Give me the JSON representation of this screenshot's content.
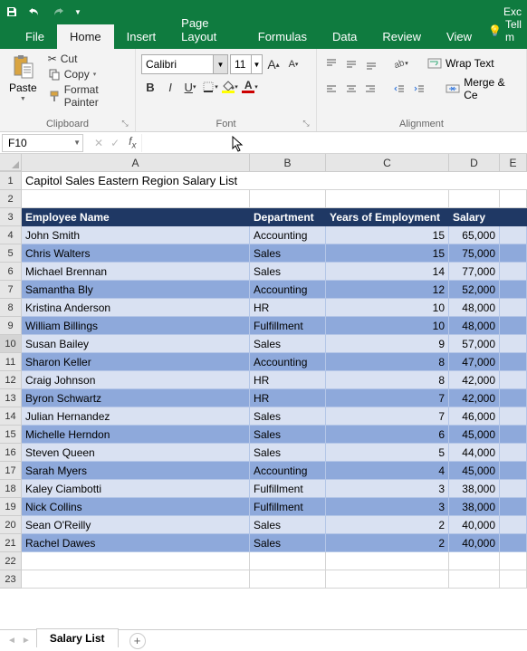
{
  "app": {
    "title": "Exc"
  },
  "tabs": [
    "File",
    "Home",
    "Insert",
    "Page Layout",
    "Formulas",
    "Data",
    "Review",
    "View"
  ],
  "active_tab": "Home",
  "tell_me": "Tell m",
  "clipboard": {
    "paste": "Paste",
    "cut": "Cut",
    "copy": "Copy",
    "format_painter": "Format Painter",
    "label": "Clipboard"
  },
  "font": {
    "name": "Calibri",
    "size": "11",
    "label": "Font"
  },
  "alignment": {
    "wrap": "Wrap Text",
    "merge": "Merge & Ce",
    "label": "Alignment"
  },
  "namebox": "F10",
  "sheet": {
    "title": "Capitol Sales Eastern Region Salary List",
    "headers": [
      "Employee Name",
      "Department",
      "Years of Employment",
      "Salary"
    ],
    "rows": [
      {
        "name": "John Smith",
        "dept": "Accounting",
        "years": "15",
        "salary": "65,000"
      },
      {
        "name": "Chris Walters",
        "dept": "Sales",
        "years": "15",
        "salary": "75,000"
      },
      {
        "name": "Michael Brennan",
        "dept": "Sales",
        "years": "14",
        "salary": "77,000"
      },
      {
        "name": "Samantha Bly",
        "dept": "Accounting",
        "years": "12",
        "salary": "52,000"
      },
      {
        "name": "Kristina Anderson",
        "dept": "HR",
        "years": "10",
        "salary": "48,000"
      },
      {
        "name": "William Billings",
        "dept": "Fulfillment",
        "years": "10",
        "salary": "48,000"
      },
      {
        "name": "Susan Bailey",
        "dept": "Sales",
        "years": "9",
        "salary": "57,000"
      },
      {
        "name": "Sharon Keller",
        "dept": "Accounting",
        "years": "8",
        "salary": "47,000"
      },
      {
        "name": "Craig Johnson",
        "dept": "HR",
        "years": "8",
        "salary": "42,000"
      },
      {
        "name": "Byron Schwartz",
        "dept": "HR",
        "years": "7",
        "salary": "42,000"
      },
      {
        "name": "Julian Hernandez",
        "dept": "Sales",
        "years": "7",
        "salary": "46,000"
      },
      {
        "name": "Michelle Herndon",
        "dept": "Sales",
        "years": "6",
        "salary": "45,000"
      },
      {
        "name": "Steven Queen",
        "dept": "Sales",
        "years": "5",
        "salary": "44,000"
      },
      {
        "name": "Sarah Myers",
        "dept": "Accounting",
        "years": "4",
        "salary": "45,000"
      },
      {
        "name": "Kaley Ciambotti",
        "dept": "Fulfillment",
        "years": "3",
        "salary": "38,000"
      },
      {
        "name": "Nick Collins",
        "dept": "Fulfillment",
        "years": "3",
        "salary": "38,000"
      },
      {
        "name": "Sean O'Reilly",
        "dept": "Sales",
        "years": "2",
        "salary": "40,000"
      },
      {
        "name": "Rachel Dawes",
        "dept": "Sales",
        "years": "2",
        "salary": "40,000"
      }
    ],
    "tab_name": "Salary List"
  },
  "cols": [
    "A",
    "B",
    "C",
    "D",
    "E"
  ]
}
